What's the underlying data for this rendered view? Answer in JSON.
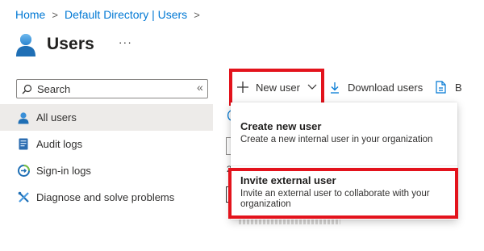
{
  "breadcrumb": {
    "items": [
      "Home",
      "Default Directory | Users"
    ],
    "separator": ">"
  },
  "header": {
    "title": "Users",
    "more": "···",
    "icon": "users-icon"
  },
  "sidebar": {
    "search_placeholder": "Search",
    "collapse": "«",
    "items": [
      {
        "label": "All users",
        "icon": "user-icon",
        "active": true
      },
      {
        "label": "Audit logs",
        "icon": "audit-log-icon",
        "active": false
      },
      {
        "label": "Sign-in logs",
        "icon": "sign-in-icon",
        "active": false
      },
      {
        "label": "Diagnose and solve problems",
        "icon": "wrench-icon",
        "active": false
      }
    ]
  },
  "toolbar": {
    "new_user": "New user",
    "download_users": "Download users",
    "extra_initial": "B"
  },
  "dropdown": {
    "items": [
      {
        "title": "Create new user",
        "description": "Create a new internal user in your organization"
      },
      {
        "title": "Invite external user",
        "description": "Invite an external user to collaborate with your organization"
      }
    ]
  },
  "colors": {
    "accent": "#0078d4",
    "highlight": "#e3131c",
    "active_bg": "#edebe9"
  }
}
